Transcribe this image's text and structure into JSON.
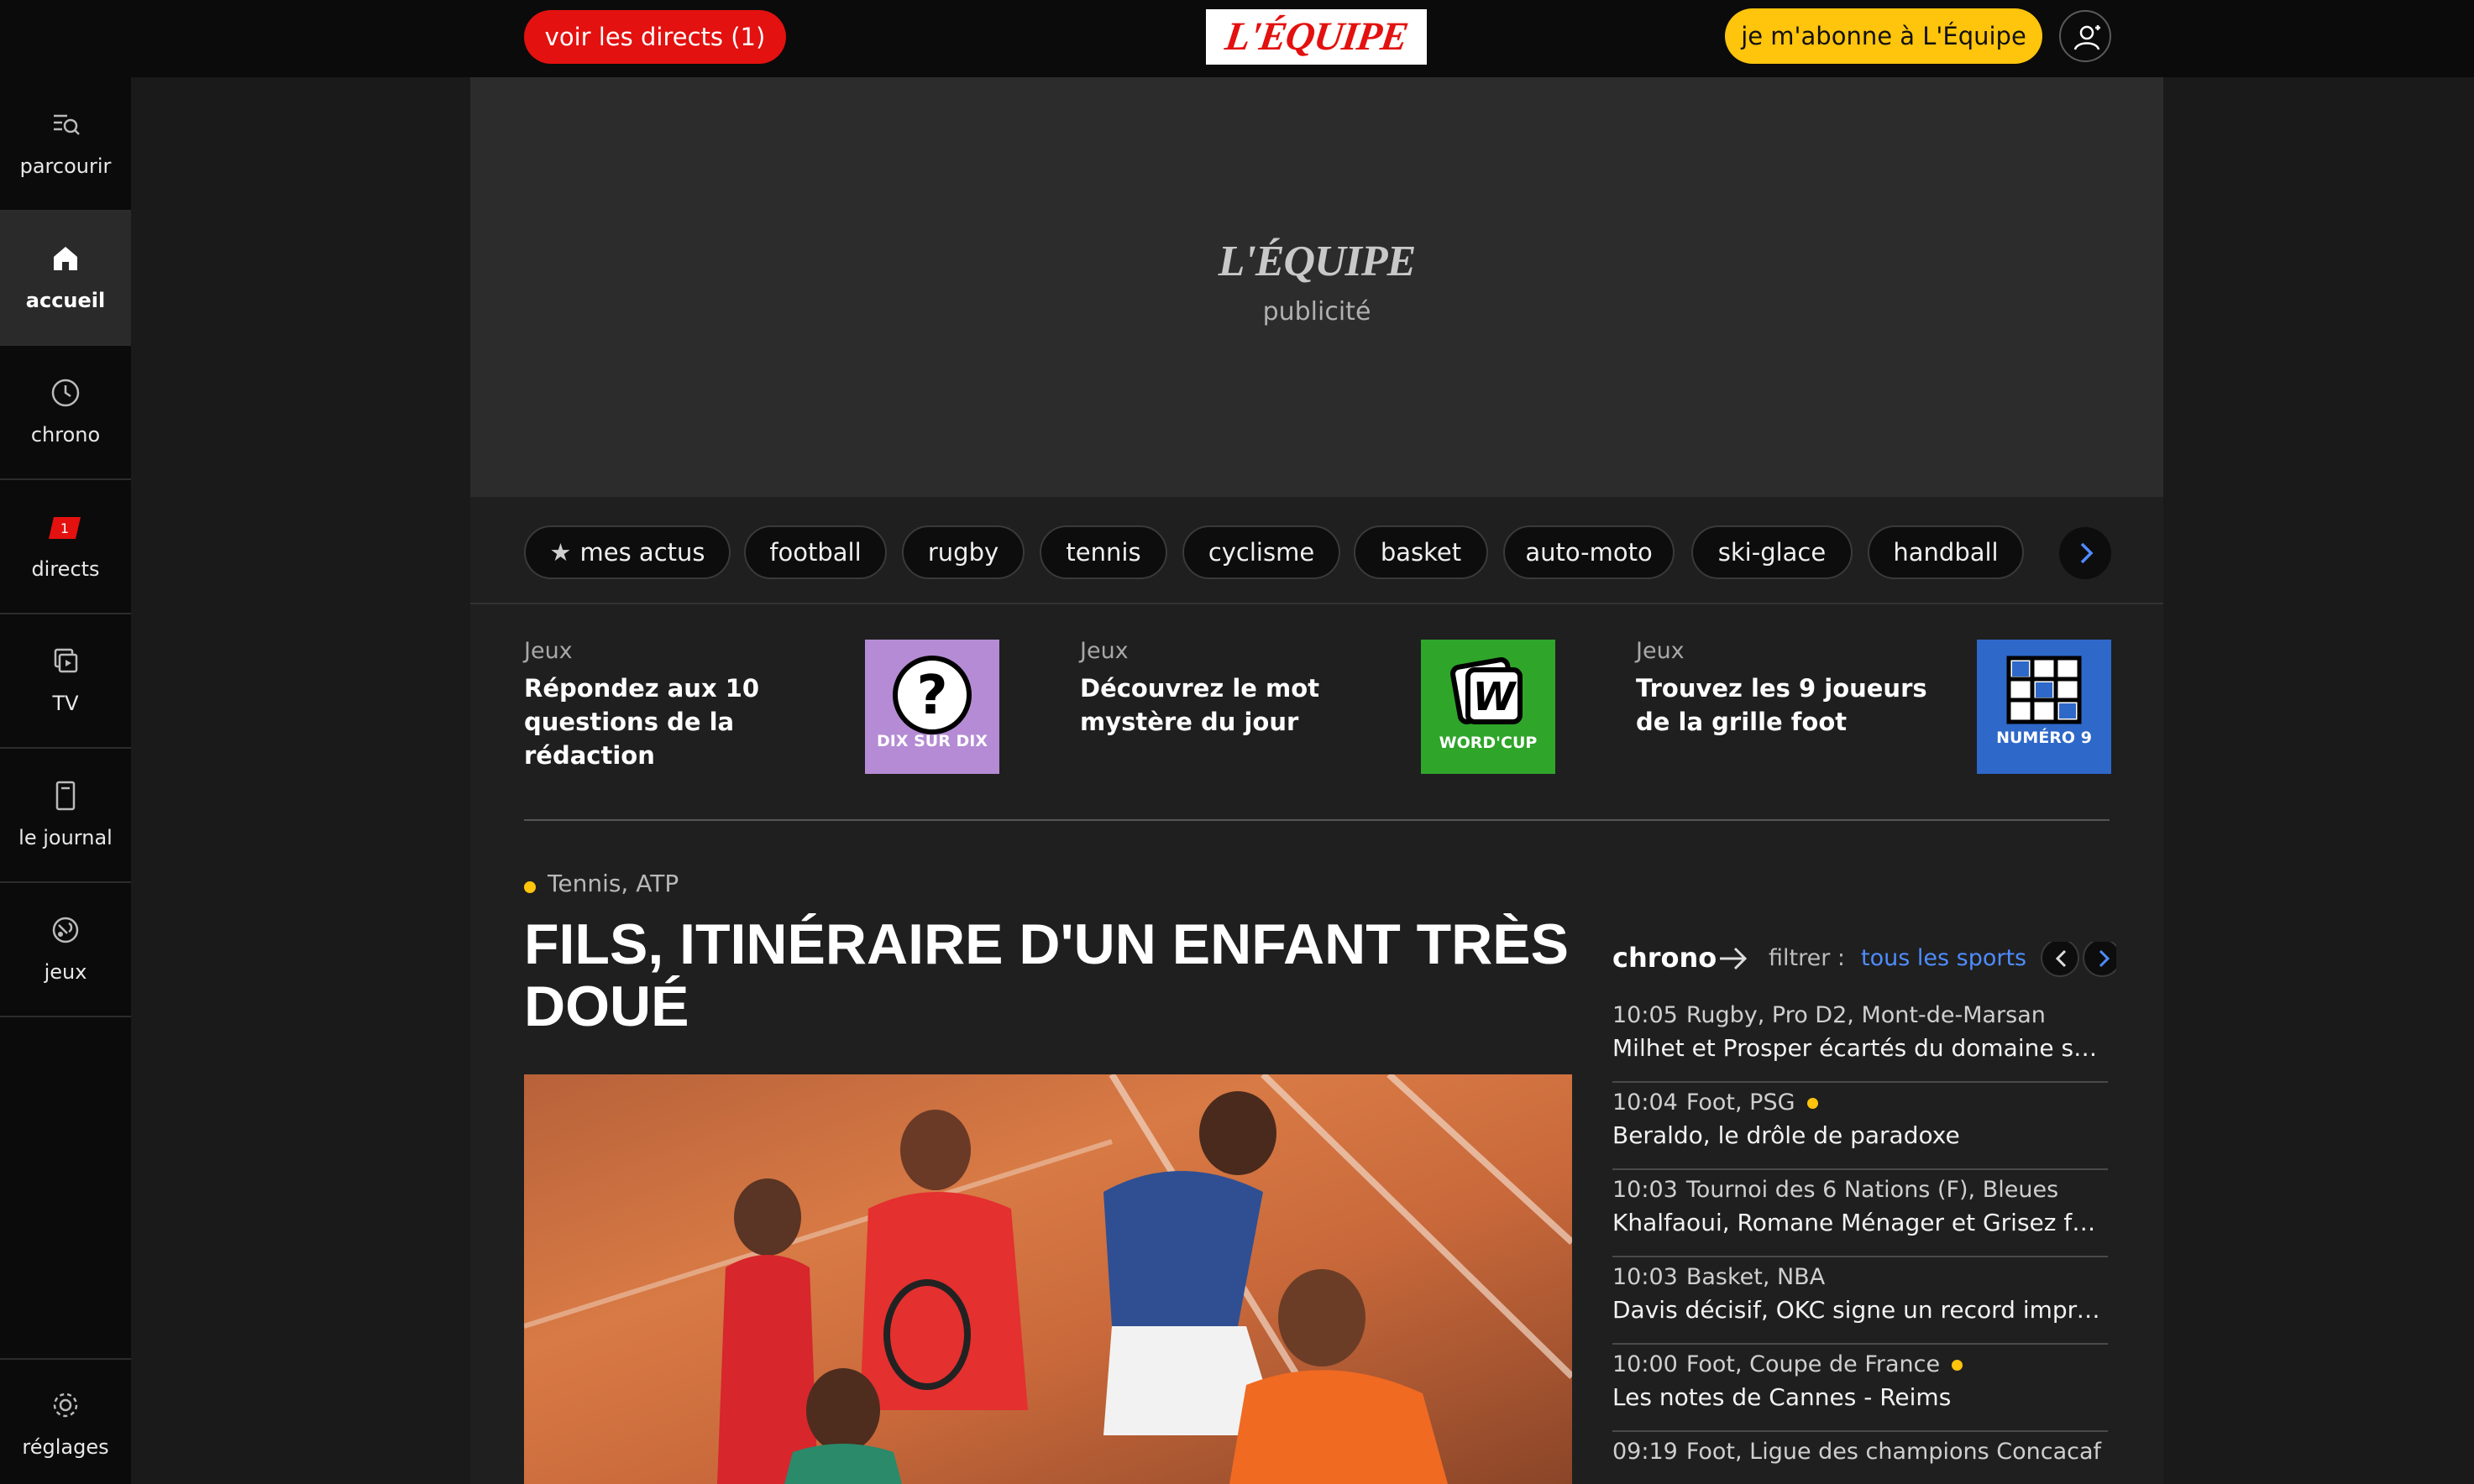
{
  "header": {
    "live_label": "voir les directs (1)",
    "logo_text": "L'ÉQUIPE",
    "subscribe_label": "je m'abonne à L'Équipe",
    "account_icon": "user-icon",
    "brand_red": "#e3110f",
    "brand_yellow": "#ffc40c"
  },
  "sidebar": {
    "items": [
      {
        "label": "parcourir",
        "icon": "browse-icon"
      },
      {
        "label": "accueil",
        "icon": "home-icon",
        "active": true
      },
      {
        "label": "chrono",
        "icon": "clock-icon"
      },
      {
        "label": "directs",
        "icon": "live-badge-icon",
        "badge": "1"
      },
      {
        "label": "TV",
        "icon": "tv-icon"
      },
      {
        "label": "le journal",
        "icon": "newspaper-icon"
      },
      {
        "label": "jeux",
        "icon": "games-icon"
      }
    ],
    "settings_label": "réglages"
  },
  "ad": {
    "logo_text": "L'ÉQUIPE",
    "label": "publicité"
  },
  "chips": {
    "items": [
      "mes actus",
      "football",
      "rugby",
      "tennis",
      "cyclisme",
      "basket",
      "auto-moto",
      "ski-glace",
      "handball"
    ]
  },
  "games": [
    {
      "kind": "Jeux",
      "title": "Répondez aux 10 questions de la rédaction",
      "thumb_label": "DIX SUR DIX",
      "thumb_color": "#b48bd4"
    },
    {
      "kind": "Jeux",
      "title": "Découvrez le mot mystère du jour",
      "thumb_label": "WORD'CUP",
      "thumb_color": "#2fa52a"
    },
    {
      "kind": "Jeux",
      "title": "Trouvez les 9 joueurs de la grille foot",
      "thumb_label": "NUMÉRO 9",
      "thumb_color": "#2e68c9"
    }
  ],
  "article": {
    "category": "Tennis, ATP",
    "headline": "FILS, ITINÉRAIRE D'UN ENFANT TRÈS DOUÉ"
  },
  "chrono": {
    "title": "chrono",
    "filter_label": "filtrer :",
    "filter_value": "tous les sports",
    "items": [
      {
        "time": "10:05",
        "meta": "Rugby, Pro D2, Mont-de-Marsan",
        "title": "Milhet et Prosper écartés du domaine sportif",
        "dot": false
      },
      {
        "time": "10:04",
        "meta": "Foot, PSG",
        "title": "Beraldo, le drôle de paradoxe",
        "dot": true
      },
      {
        "time": "10:03",
        "meta": "Tournoi des 6 Nations (F), Bleues",
        "title": "Khalfaoui, Romane Ménager et Grisez font l...",
        "dot": false
      },
      {
        "time": "10:03",
        "meta": "Basket, NBA",
        "title": "Davis décisif, OKC signe un record impressi...",
        "dot": false
      },
      {
        "time": "10:00",
        "meta": "Foot, Coupe de France",
        "title": "Les notes de Cannes - Reims",
        "dot": true
      },
      {
        "time": "09:19",
        "meta": "Foot, Ligue des champions Concacaf",
        "title": "",
        "dot": false
      }
    ]
  }
}
